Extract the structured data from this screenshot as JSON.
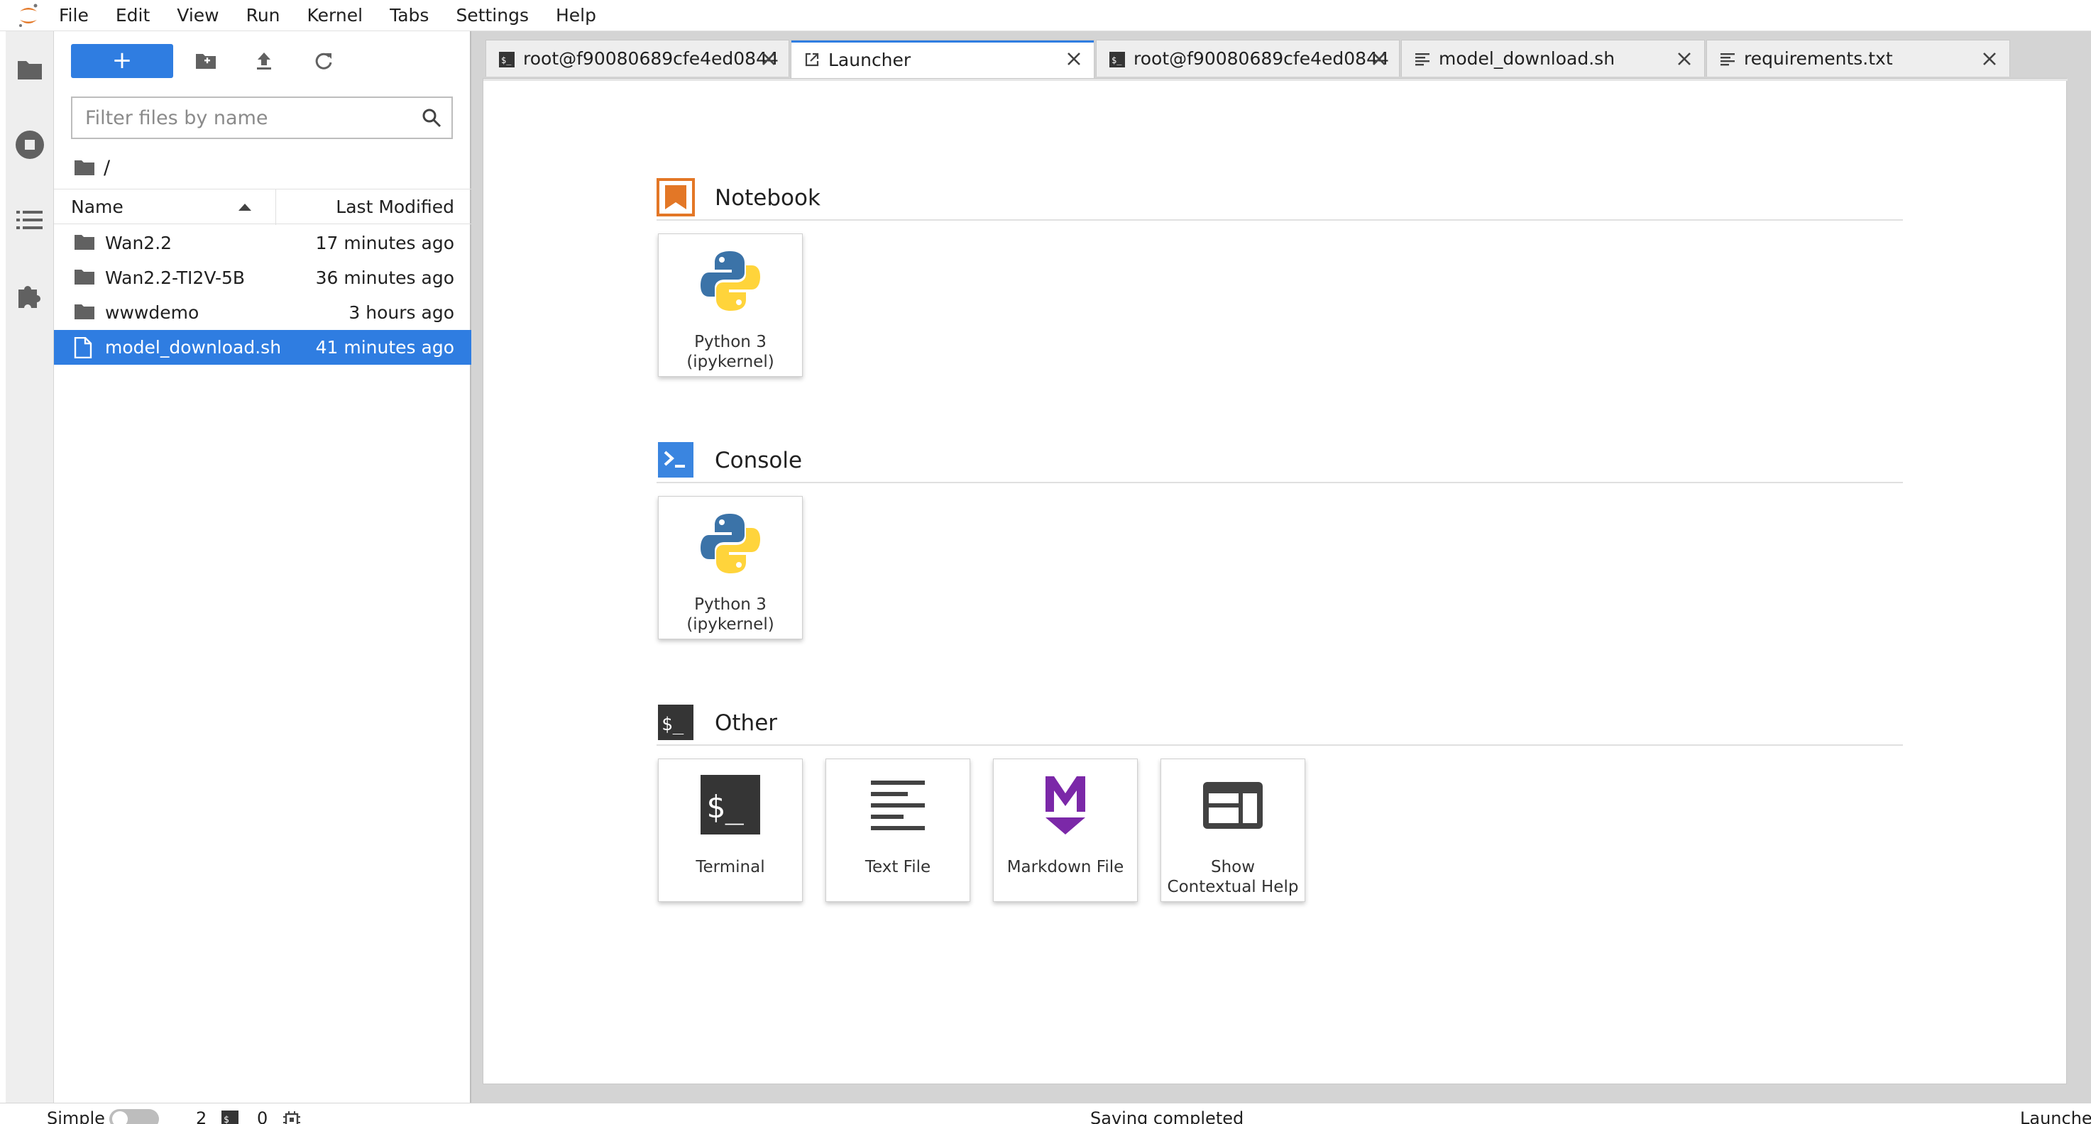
{
  "menubar": {
    "items": [
      "File",
      "Edit",
      "View",
      "Run",
      "Kernel",
      "Tabs",
      "Settings",
      "Help"
    ]
  },
  "activity_bar": {
    "icons": [
      "folder-icon",
      "stop-circle-icon",
      "list-icon",
      "puzzle-icon"
    ]
  },
  "file_browser": {
    "new_label": "+",
    "filter_placeholder": "Filter files by name",
    "breadcrumb": "/",
    "columns": {
      "name": "Name",
      "modified": "Last Modified"
    },
    "rows": [
      {
        "name": "Wan2.2",
        "modified": "17 minutes ago",
        "kind": "folder"
      },
      {
        "name": "Wan2.2-TI2V-5B",
        "modified": "36 minutes ago",
        "kind": "folder"
      },
      {
        "name": "wwwdemo",
        "modified": "3 hours ago",
        "kind": "folder"
      },
      {
        "name": "model_download.sh",
        "modified": "41 minutes ago",
        "kind": "file",
        "selected": true
      }
    ]
  },
  "tabs": [
    {
      "label": "root@f90080689cfe4ed0844",
      "icon": "terminal-icon",
      "active": false
    },
    {
      "label": "Launcher",
      "icon": "launch-icon",
      "active": true
    },
    {
      "label": "root@f90080689cfe4ed0844",
      "icon": "terminal-icon",
      "active": false
    },
    {
      "label": "model_download.sh",
      "icon": "text-file-icon",
      "active": false
    },
    {
      "label": "requirements.txt",
      "icon": "text-file-icon",
      "active": false
    }
  ],
  "launcher": {
    "sections": [
      {
        "title": "Notebook",
        "cards": [
          {
            "label": "Python 3 (ipykernel)"
          }
        ]
      },
      {
        "title": "Console",
        "cards": [
          {
            "label": "Python 3 (ipykernel)"
          }
        ]
      },
      {
        "title": "Other",
        "cards": [
          {
            "label": "Terminal"
          },
          {
            "label": "Text File"
          },
          {
            "label": "Markdown File"
          },
          {
            "label": "Show Contextual Help"
          }
        ]
      }
    ]
  },
  "statusbar": {
    "mode_label": "Simple",
    "terminals_count": "2",
    "kernels_count": "0",
    "message": "Saving completed",
    "right_label": "Launcher"
  },
  "colors": {
    "accent": "#2f7de1",
    "notebook_orange": "#e37726",
    "console_blue": "#3a85e0",
    "terminal_dark": "#353535",
    "markdown_purple": "#7b28a8"
  }
}
